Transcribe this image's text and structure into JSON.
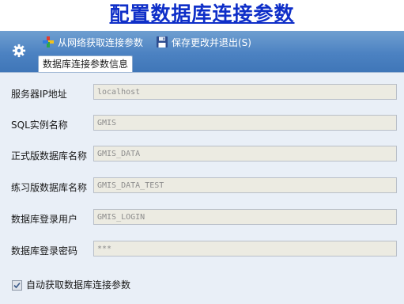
{
  "window": {
    "title": "配置数据库连接参数"
  },
  "toolbar": {
    "fetch_label": "从网络获取连接参数",
    "save_label": "保存更改并退出(S)"
  },
  "tabs": [
    {
      "label": "数据库连接参数信息",
      "active": true
    }
  ],
  "form": {
    "fields": [
      {
        "label": "服务器IP地址",
        "value": "localhost"
      },
      {
        "label": "SQL实例名称",
        "value": "GMIS"
      },
      {
        "label": "正式版数据库名称",
        "value": "GMIS_DATA"
      },
      {
        "label": "练习版数据库名称",
        "value": "GMIS_DATA_TEST"
      },
      {
        "label": "数据库登录用户",
        "value": "GMIS_LOGIN"
      },
      {
        "label": "数据库登录密码",
        "value": "***"
      }
    ],
    "auto_fetch": {
      "label": "自动获取数据库连接参数",
      "checked": true
    }
  },
  "colors": {
    "title": "#0f2fc8",
    "toolbar": "#4c82c2",
    "panel_bg": "#e9eff7",
    "field_bg": "#ecebe2"
  },
  "icons": [
    "gear-icon",
    "colorful-plus-icon",
    "floppy-disk-icon",
    "checkmark-icon"
  ]
}
